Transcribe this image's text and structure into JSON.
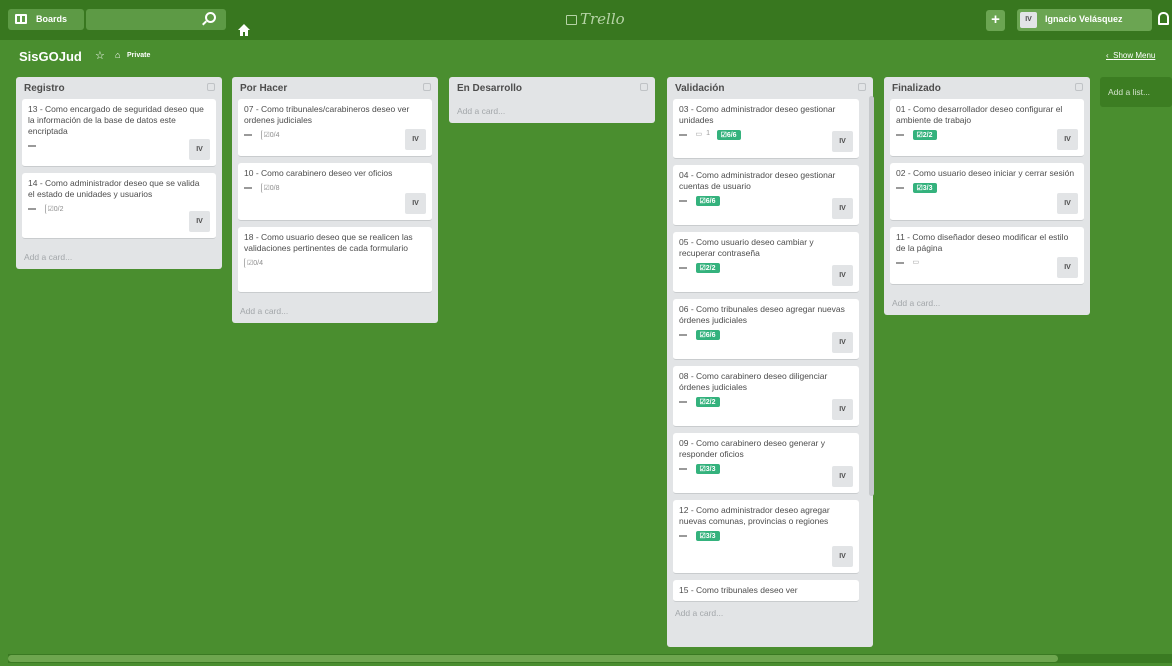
{
  "header": {
    "boards_label": "Boards",
    "search_placeholder": "",
    "logo_text": "Trello",
    "add_label": "+",
    "user_initials": "IV",
    "user_name": "Ignacio Velásquez"
  },
  "board": {
    "title": "SisGOJud",
    "visibility": "Private",
    "show_menu": "Show Menu",
    "add_list": "Add a list..."
  },
  "lists": [
    {
      "name": "Registro",
      "add_card": "Add a card...",
      "cards": [
        {
          "title": "13 - Como encargado de seguridad deseo que la información de la base de datos este encriptada",
          "checklist": "",
          "comments": "",
          "member": "IV",
          "done": false
        },
        {
          "title": "14 - Como administrador deseo que se valida el estado de unidades y usuarios",
          "checklist": "0/2",
          "comments": "",
          "member": "IV",
          "done": false
        }
      ]
    },
    {
      "name": "Por Hacer",
      "add_card": "Add a card...",
      "cards": [
        {
          "title": "07 - Como tribunales/carabineros deseo ver ordenes judiciales",
          "checklist": "0/4",
          "comments": "",
          "member": "IV",
          "done": false
        },
        {
          "title": "10 - Como carabinero deseo ver oficios",
          "checklist": "0/8",
          "comments": "",
          "member": "IV",
          "done": false
        },
        {
          "title": "18 - Como usuario deseo que se realicen las validaciones pertinentes de cada formulario",
          "checklist": "0/4",
          "comments": "",
          "member": "",
          "done": false
        }
      ]
    },
    {
      "name": "En Desarrollo",
      "add_card": "Add a card...",
      "cards": []
    },
    {
      "name": "Validación",
      "add_card": "Add a card...",
      "cards": [
        {
          "title": "03 - Como administrador deseo gestionar unidades",
          "checklist": "6/6",
          "comments": "1",
          "member": "IV",
          "done": true
        },
        {
          "title": "04 - Como administrador deseo gestionar cuentas de usuario",
          "checklist": "6/6",
          "comments": "",
          "member": "IV",
          "done": true
        },
        {
          "title": "05 - Como usuario deseo cambiar y recuperar contraseña",
          "checklist": "2/2",
          "comments": "",
          "member": "IV",
          "done": true
        },
        {
          "title": "06 - Como tribunales deseo agregar nuevas órdenes judiciales",
          "checklist": "6/6",
          "comments": "",
          "member": "IV",
          "done": true
        },
        {
          "title": "08 - Como carabinero deseo diligenciar órdenes judiciales",
          "checklist": "2/2",
          "comments": "",
          "member": "IV",
          "done": true
        },
        {
          "title": "09 - Como carabinero deseo generar y responder oficios",
          "checklist": "3/3",
          "comments": "",
          "member": "IV",
          "done": true
        },
        {
          "title": "12 - Como administrador deseo agregar nuevas comunas, provincias o regiones",
          "checklist": "3/3",
          "comments": "",
          "member": "IV",
          "done": true
        },
        {
          "title": "15 - Como tribunales deseo ver",
          "checklist": "",
          "comments": "",
          "member": "",
          "done": false
        }
      ]
    },
    {
      "name": "Finalizado",
      "add_card": "Add a card...",
      "cards": [
        {
          "title": "01 - Como desarrollador deseo configurar el ambiente de trabajo",
          "checklist": "2/2",
          "comments": "",
          "member": "IV",
          "done": true
        },
        {
          "title": "02 - Como usuario deseo iniciar y cerrar sesión",
          "checklist": "3/3",
          "comments": "",
          "member": "IV",
          "done": true
        },
        {
          "title": "11 - Como diseñador deseo modificar el estilo de la página",
          "checklist": "",
          "comments": "",
          "member": "IV",
          "done": false
        }
      ]
    }
  ],
  "colors": {
    "background": "#4a8e2f",
    "topbar": "#38771f",
    "list": "#e2e4e6",
    "done_badge": "#34b27d"
  }
}
